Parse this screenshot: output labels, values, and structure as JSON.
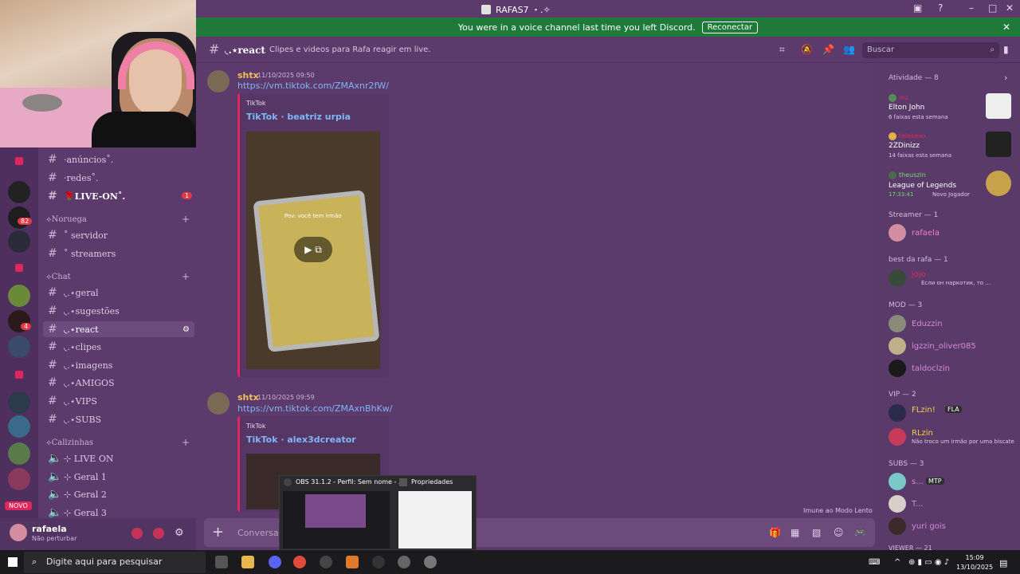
{
  "titlebar": {
    "title": "RAFAS7 ・.✧"
  },
  "banner": {
    "text": "You were in a voice channel last time you left Discord.",
    "button": "Reconectar"
  },
  "server_rail": {
    "badge_82": "82",
    "badge_4": "4",
    "novo": "NOVO"
  },
  "channels": {
    "top": [
      {
        "name": "·anúncios˚.",
        "bold": false
      },
      {
        "name": "·redes˚.",
        "bold": false
      },
      {
        "name": "🌹LIVE-ON˚.",
        "bold": true,
        "badge": "1"
      }
    ],
    "categories": [
      {
        "name": "⟡Noruega",
        "items": [
          "˚ servidor",
          "˚ streamers"
        ]
      },
      {
        "name": "⟡Chat",
        "items": [
          "◟.⋆geral",
          "◟.⋆sugestões",
          "◟.⋆react",
          "◟.⋆clipes",
          "◟.⋆imagens",
          "◟.⋆AMIGOS",
          "◟.⋆VIPS",
          "◟.⋆SUBS"
        ]
      },
      {
        "name": "⟡Callzinhas",
        "items": [
          "⊹ LIVE ON",
          "⊹ Geral 1",
          "⊹ Geral 2",
          "⊹ Geral 3"
        ]
      }
    ],
    "active": "◟.⋆react"
  },
  "user": {
    "name": "rafaela",
    "status": "Não perturbar"
  },
  "channel_header": {
    "name": "◟.⋆react",
    "topic": "Clipes e videos para Rafa reagir em live.",
    "search_placeholder": "Buscar"
  },
  "messages": [
    {
      "author": "shtx",
      "time": "11/10/2025 09:50",
      "link": "https://vm.tiktok.com/ZMAxnr2fW/",
      "embed_provider": "TikTok",
      "embed_title": "TikTok · beatriz urpia",
      "caption": "Pov: você tem irmão"
    },
    {
      "author": "shtx",
      "time": "11/10/2025 09:59",
      "link": "https://vm.tiktok.com/ZMAxnBhKw/",
      "embed_provider": "TikTok",
      "embed_title": "TikTok · alex3dcreator"
    }
  ],
  "composer": {
    "placeholder": "Conversar e",
    "slowmode": "Imune ao Modo Lento"
  },
  "members": {
    "activity_header": "Atividade — 8",
    "activities": [
      {
        "user": "mz",
        "game": "Elton John",
        "detail": "6 faixas esta semana"
      },
      {
        "user": "telesexo",
        "game": "2ZDinizz",
        "detail": "14 faixas esta semana"
      },
      {
        "user": "theuszin",
        "game": "League of Legends",
        "detail": "17:33:41",
        "extra": "Novo Jogador"
      }
    ],
    "sections": [
      {
        "header": "Streamer — 1",
        "members": [
          {
            "name": "rafaela",
            "sub": ""
          }
        ]
      },
      {
        "header": "best da rafa — 1",
        "members": [
          {
            "name": "jojo",
            "sub": "Если он наркотик, то ..."
          }
        ]
      },
      {
        "header": "MOD — 3",
        "members": [
          {
            "name": "Eduzzin",
            "sub": ""
          },
          {
            "name": "lgzzin_oliver085",
            "sub": ""
          },
          {
            "name": "taldoclzin",
            "sub": ""
          }
        ]
      },
      {
        "header": "VIP — 2",
        "members": [
          {
            "name": "FLzin!",
            "sub": "",
            "tag": "FLA"
          },
          {
            "name": "RLzin",
            "sub": "Não troco um irmão por uma biscate"
          }
        ]
      },
      {
        "header": "SUBS — 3",
        "members": [
          {
            "name": "s...",
            "sub": "",
            "tag": "MTP"
          },
          {
            "name": "T...",
            "sub": ""
          },
          {
            "name": "yuri gois",
            "sub": ""
          }
        ]
      }
    ],
    "cut_header": "VIEWER — 21"
  },
  "taskbar": {
    "search_placeholder": "Digite aqui para pesquisar",
    "time": "15:09",
    "date": "13/10/2025",
    "obs_preview_title": "OBS 31.1.2 - Perfil: Sem nome - ...",
    "props_preview_title": "Propriedades"
  },
  "colors": {
    "bg": "#5c3b6c",
    "banner": "#1f7a39",
    "accent_link": "#7fb6f5",
    "embed_border": "#e0265c"
  }
}
